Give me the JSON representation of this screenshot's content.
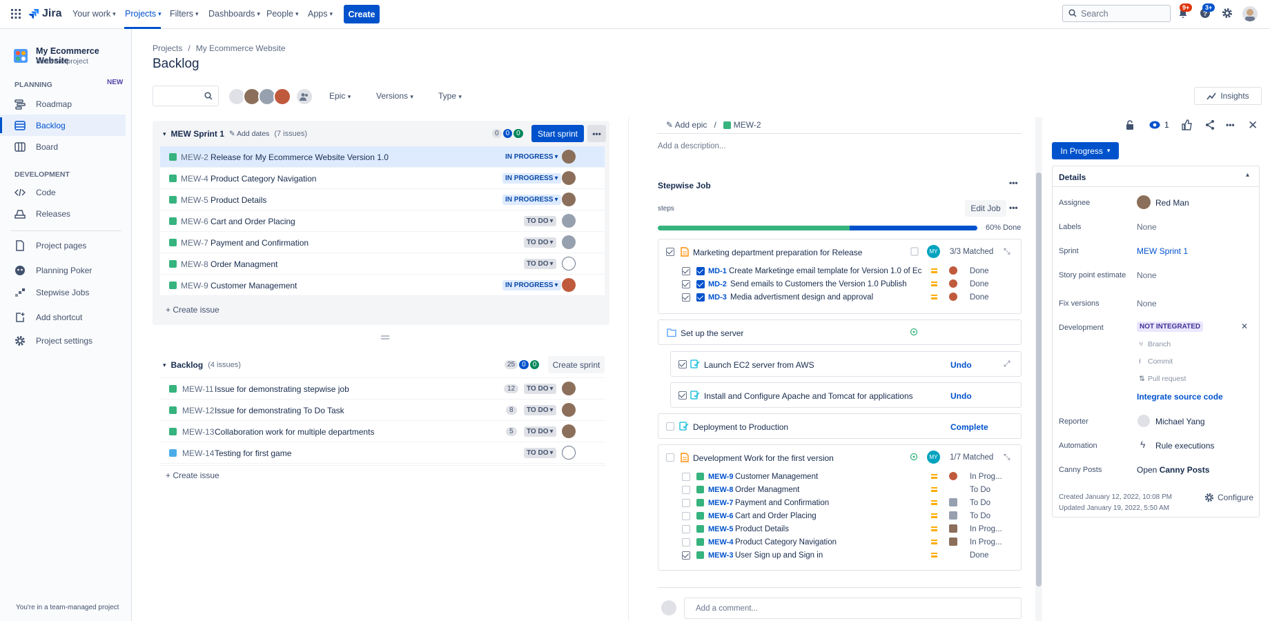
{
  "nav": {
    "logo": "Jira",
    "items": [
      {
        "label": "Your work"
      },
      {
        "label": "Projects"
      },
      {
        "label": "Filters"
      },
      {
        "label": "Dashboards"
      },
      {
        "label": "People"
      },
      {
        "label": "Apps"
      }
    ],
    "create_label": "Create",
    "search_placeholder": "Search",
    "notifications_badge": "9+",
    "help_badge": "3+"
  },
  "sidebar": {
    "project_name": "My Ecommerce Website",
    "project_type": "Software project",
    "planning_heading": "PLANNING",
    "new_badge": "NEW",
    "planning_items": [
      "Roadmap",
      "Backlog",
      "Board"
    ],
    "development_heading": "DEVELOPMENT",
    "development_items": [
      "Code",
      "Releases"
    ],
    "other_items": [
      "Project pages",
      "Planning Poker",
      "Stepwise Jobs",
      "Add shortcut",
      "Project settings"
    ],
    "footer": "You're in a team-managed project"
  },
  "page": {
    "breadcrumb_projects": "Projects",
    "breadcrumb_sep": "/",
    "breadcrumb_project": "My Ecommerce Website",
    "title": "Backlog",
    "filters": {
      "epic": "Epic",
      "versions": "Versions",
      "type": "Type"
    },
    "insights": "Insights"
  },
  "sprint": {
    "name": "MEW Sprint 1",
    "add_dates": "Add dates",
    "issue_count": "(7 issues)",
    "counts": [
      "0",
      "0",
      "0"
    ],
    "start_label": "Start sprint",
    "create_issue": "+ Create issue",
    "issues": [
      {
        "key": "MEW-2",
        "summary": "Release for My Ecommerce Website Version 1.0",
        "status": "IN PROGRESS"
      },
      {
        "key": "MEW-4",
        "summary": "Product Category Navigation",
        "status": "IN PROGRESS"
      },
      {
        "key": "MEW-5",
        "summary": "Product Details",
        "status": "IN PROGRESS"
      },
      {
        "key": "MEW-6",
        "summary": "Cart and Order Placing",
        "status": "TO DO"
      },
      {
        "key": "MEW-7",
        "summary": "Payment and Confirmation",
        "status": "TO DO"
      },
      {
        "key": "MEW-8",
        "summary": "Order Managment",
        "status": "TO DO"
      },
      {
        "key": "MEW-9",
        "summary": "Customer Management",
        "status": "IN PROGRESS"
      }
    ]
  },
  "backlog": {
    "name": "Backlog",
    "issue_count": "(4 issues)",
    "counts": [
      "25",
      "0",
      "0"
    ],
    "create_sprint": "Create sprint",
    "create_issue": "+ Create issue",
    "issues": [
      {
        "key": "MEW-11",
        "summary": "Issue for demonstrating stepwise job",
        "estimate": "12",
        "status": "TO DO"
      },
      {
        "key": "MEW-12",
        "summary": "Issue for demonstrating To Do Task",
        "estimate": "8",
        "status": "TO DO"
      },
      {
        "key": "MEW-13",
        "summary": "Collaboration work for multiple departments",
        "estimate": "5",
        "status": "TO DO"
      },
      {
        "key": "MEW-14",
        "summary": "Testing for first game",
        "estimate": "",
        "status": "TO DO"
      }
    ]
  },
  "detail": {
    "add_epic": "Add epic",
    "issue_key": "MEW-2",
    "add_description": "Add a description...",
    "job_title": "Stepwise Job",
    "steps_label": "steps",
    "edit_job": "Edit Job",
    "progress_green": 0.6,
    "progress_blue": 0.4,
    "progress_text": "60% Done",
    "groups": {
      "marketing": {
        "title": "Marketing department preparation for Release",
        "avatar": "MY",
        "matched": "3/3 Matched",
        "items": [
          {
            "key": "MD-1",
            "text": "Create Marketinge email template for Version 1.0 of Ec...",
            "status": "Done"
          },
          {
            "key": "MD-2",
            "text": "Send emails to Customers the Version 1.0 Publish",
            "status": "Done"
          },
          {
            "key": "MD-3",
            "text": "Media advertisment design and approval",
            "status": "Done"
          }
        ]
      },
      "server": {
        "title": "Set up the server"
      },
      "ec2": {
        "title": "Launch EC2 server from AWS",
        "action": "Undo"
      },
      "apache": {
        "title": "Install and Configure Apache and Tomcat for applications",
        "action": "Undo"
      },
      "deploy": {
        "title": "Deployment to Production",
        "action": "Complete"
      },
      "devwork": {
        "title": "Development Work for the first version",
        "avatar": "MY",
        "matched": "1/7 Matched",
        "items": [
          {
            "key": "MEW-9",
            "text": "Customer Management",
            "status": "In Prog..."
          },
          {
            "key": "MEW-8",
            "text": "Order Managment",
            "status": "To Do"
          },
          {
            "key": "MEW-7",
            "text": "Payment and Confirmation",
            "status": "To Do"
          },
          {
            "key": "MEW-6",
            "text": "Cart and Order Placing",
            "status": "To Do"
          },
          {
            "key": "MEW-5",
            "text": "Product Details",
            "status": "In Prog..."
          },
          {
            "key": "MEW-4",
            "text": "Product Category Navigation",
            "status": "In Prog..."
          },
          {
            "key": "MEW-3",
            "text": "User Sign up and Sign in",
            "status": "Done"
          }
        ]
      }
    },
    "comment_placeholder": "Add a comment..."
  },
  "details_panel": {
    "watch_count": "1",
    "status_button": "In Progress",
    "heading": "Details",
    "assignee_label": "Assignee",
    "assignee": "Red Man",
    "labels_label": "Labels",
    "labels": "None",
    "sprint_label": "Sprint",
    "sprint": "MEW Sprint 1",
    "story_label": "Story point estimate",
    "story": "None",
    "fix_label": "Fix versions",
    "fix": "None",
    "dev_label": "Development",
    "dev_status": "NOT INTEGRATED",
    "dev_branch": "Branch",
    "dev_commit": "Commit",
    "dev_pr": "Pull request",
    "integrate": "Integrate source code",
    "reporter_label": "Reporter",
    "reporter": "Michael Yang",
    "automation_label": "Automation",
    "automation": "Rule executions",
    "canny_label": "Canny Posts",
    "canny_open": "Open",
    "canny_posts": "Canny Posts",
    "created": "Created January 12, 2022, 10:08 PM",
    "updated": "Updated January 19, 2022, 5:50 AM",
    "configure": "Configure"
  },
  "colors": {
    "brand": "#0052cc",
    "done_green": "#36b37e",
    "story_green": "#36b37e"
  }
}
